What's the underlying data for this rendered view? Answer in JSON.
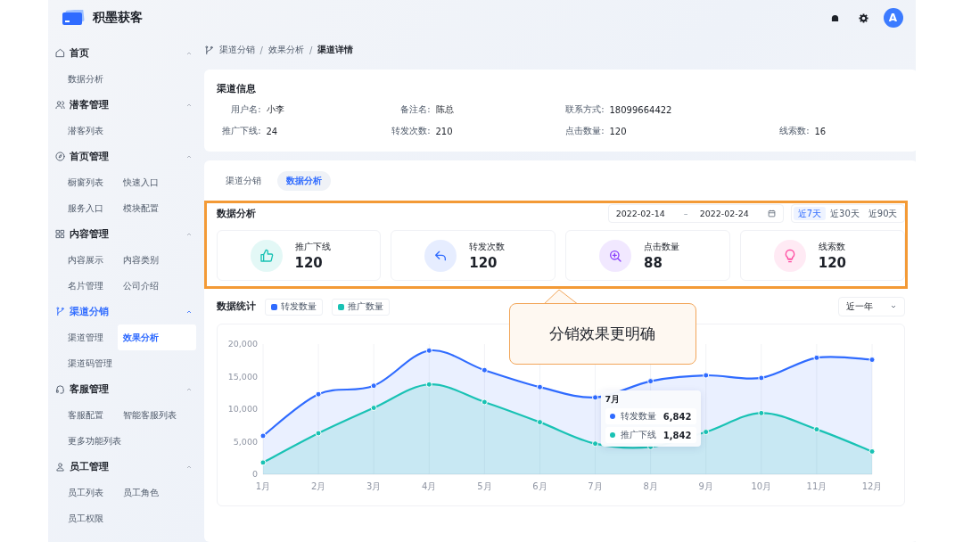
{
  "app": {
    "name": "积墨获客"
  },
  "header": {
    "avatar": "A"
  },
  "sidebar": {
    "groups": [
      {
        "label": "首页",
        "expanded": true,
        "selected": false,
        "items": [
          {
            "label": "数据分析",
            "selected": false
          }
        ]
      },
      {
        "label": "潜客管理",
        "expanded": true,
        "selected": false,
        "items": [
          {
            "label": "潜客列表",
            "selected": false
          }
        ]
      },
      {
        "label": "首页管理",
        "expanded": true,
        "selected": false,
        "items": [
          {
            "label": "橱窗列表",
            "selected": false
          },
          {
            "label": "快速入口",
            "selected": false
          },
          {
            "label": "服务入口",
            "selected": false
          },
          {
            "label": "模块配置",
            "selected": false
          }
        ]
      },
      {
        "label": "内容管理",
        "expanded": true,
        "selected": false,
        "items": [
          {
            "label": "内容展示",
            "selected": false
          },
          {
            "label": "内容类别",
            "selected": false
          },
          {
            "label": "名片管理",
            "selected": false
          },
          {
            "label": "公司介绍",
            "selected": false
          }
        ]
      },
      {
        "label": "渠道分销",
        "expanded": true,
        "selected": true,
        "items": [
          {
            "label": "渠道管理",
            "selected": false
          },
          {
            "label": "效果分析",
            "selected": true
          },
          {
            "label": "渠道码管理",
            "selected": false
          }
        ]
      },
      {
        "label": "客服管理",
        "expanded": true,
        "selected": false,
        "items": [
          {
            "label": "客服配置",
            "selected": false
          },
          {
            "label": "智能客服列表",
            "selected": false
          },
          {
            "label": "更多功能列表",
            "selected": false
          }
        ]
      },
      {
        "label": "员工管理",
        "expanded": true,
        "selected": false,
        "items": [
          {
            "label": "员工列表",
            "selected": false
          },
          {
            "label": "员工角色",
            "selected": false
          },
          {
            "label": "员工权限",
            "selected": false
          }
        ]
      }
    ]
  },
  "breadcrumb": {
    "separator": "/",
    "items": [
      "渠道分销",
      "效果分析",
      "渠道详情"
    ]
  },
  "info": {
    "title": "渠道信息",
    "rows": [
      [
        {
          "label": "用户名:",
          "value": "小李"
        },
        {
          "label": "备注名:",
          "value": "陈总"
        },
        {
          "label": "联系方式:",
          "value": "18099664422"
        }
      ],
      [
        {
          "label": "推广下线:",
          "value": "24"
        },
        {
          "label": "转发次数:",
          "value": "210"
        },
        {
          "label": "点击数量:",
          "value": "120"
        },
        {
          "label": "线索数:",
          "value": "16"
        }
      ]
    ]
  },
  "tabs": [
    {
      "label": "渠道分销",
      "selected": false
    },
    {
      "label": "数据分析",
      "selected": true
    }
  ],
  "analysis": {
    "title": "数据分析",
    "date_from": "2022-02-14",
    "date_sep": "–",
    "date_to": "2022-02-24",
    "ranges": [
      {
        "label": "近7天",
        "selected": true
      },
      {
        "label": "近30天",
        "selected": false
      },
      {
        "label": "近90天",
        "selected": false
      }
    ],
    "stats": [
      {
        "color": "#19c2b4",
        "label": "推广下线",
        "value": "120"
      },
      {
        "color": "#2f6bff",
        "label": "转发次数",
        "value": "120"
      },
      {
        "color": "#8a3ffc",
        "label": "点击数量",
        "value": "88"
      },
      {
        "color": "#ff4fa3",
        "label": "线索数",
        "value": "120"
      }
    ]
  },
  "stats_section": {
    "title": "数据统计",
    "period": "近一年",
    "chart_data": {
      "type": "area",
      "grid": true,
      "categories": [
        "1月",
        "2月",
        "3月",
        "4月",
        "5月",
        "6月",
        "7月",
        "8月",
        "9月",
        "10月",
        "11月",
        "12月"
      ],
      "ylim": [
        0,
        20000
      ],
      "yticks": [
        {
          "value": 0,
          "label": "0"
        },
        {
          "value": 5000,
          "label": "5,000"
        },
        {
          "value": 10000,
          "label": "10,000"
        },
        {
          "value": 15000,
          "label": "15,000"
        },
        {
          "value": 20000,
          "label": "20,000"
        }
      ],
      "series": [
        {
          "name": "转发数量",
          "color": "#2f6bff",
          "marker": true,
          "values": [
            5900,
            12300,
            13600,
            19000,
            16000,
            13400,
            11800,
            14300,
            15200,
            14800,
            17900,
            17600
          ]
        },
        {
          "name": "推广数量",
          "color": "#19c2b4",
          "marker": true,
          "values": [
            1800,
            6300,
            10200,
            13800,
            11100,
            8000,
            4700,
            4200,
            6500,
            9400,
            6900,
            3500
          ]
        }
      ]
    },
    "tooltip": {
      "title": "7月",
      "rows": [
        {
          "label": "转发数量",
          "value": "6,842",
          "color": "#2f6bff"
        },
        {
          "label": "推广下线",
          "value": "1,842",
          "color": "#19c2b4"
        }
      ]
    }
  },
  "callout": {
    "text": "分销效果更明确"
  }
}
